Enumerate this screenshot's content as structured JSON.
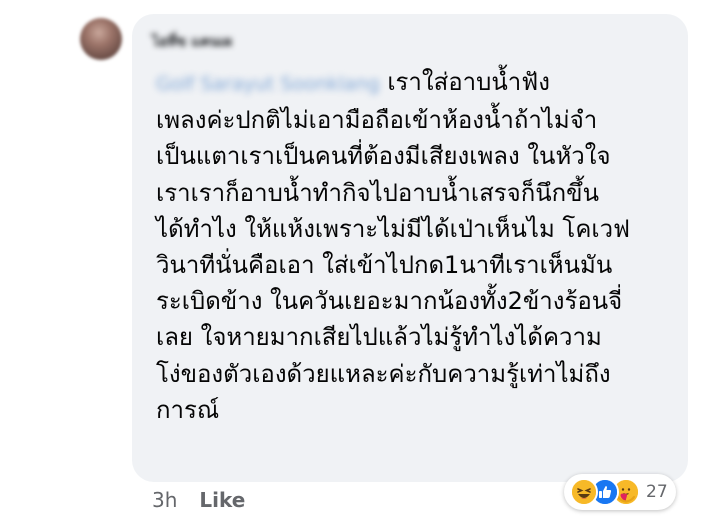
{
  "comment": {
    "author_name": "ไอที่ข แคนเผ",
    "mention": "Golf Sarayut Soonklang",
    "lines": [
      "เราใส่อาบน้ำฟัง",
      "เพลงค่ะปกติไม่เอามือถือเข้าห้องน้ำถ้าไม่จำ",
      "เป็นแตาเราเป็นคนที่ต้องมีเสียงเพลง ในหัวใจ",
      "เราเราก็อาบน้ำทำกิจไปอาบน้ำเสรจก็นึกขึ้น",
      "ได้ทำไง ให้แห้งเพราะไม่มีได้เป่าเห็นไม โคเวฟ",
      "วินาทีนั่นคือเอา ใส่เข้าไปกด1นาทีเราเห็นมัน",
      "ระเบิดข้าง ในควันเยอะมากน้องทั้ง2ข้างร้อนจี่",
      "เลย ใจหายมากเสียไปแล้วไม่รู้ทำไงได้ความ",
      "โง่ของตัวเองด้วยแหละค่ะกับความรู้เท่าไม่ถึง",
      "การณ์"
    ]
  },
  "footer": {
    "timestamp": "3h",
    "like_label": "Like"
  },
  "reactions": {
    "count": "27",
    "icons": [
      "haha-icon",
      "like-icon",
      "care-icon"
    ],
    "colors": {
      "haha": "#f7b928",
      "like": "#1877f2",
      "care": "#f7b928"
    }
  }
}
